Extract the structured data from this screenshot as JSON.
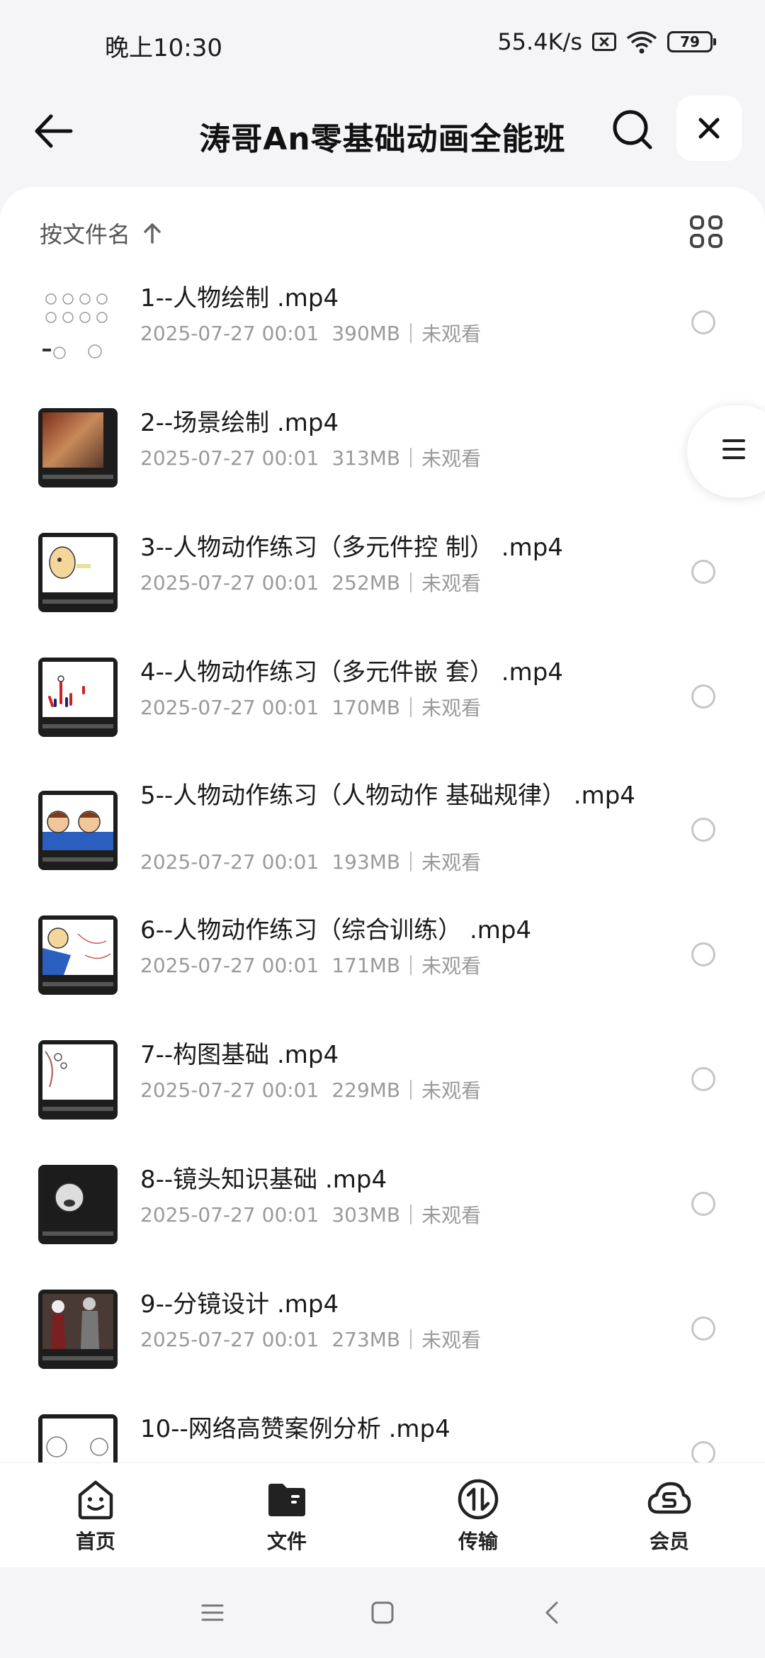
{
  "status": {
    "time": "晚上10:30",
    "speed": "55.4K/s",
    "battery": "79"
  },
  "header": {
    "title": "涛哥An零基础动画全能班"
  },
  "toolbar": {
    "sort_label": "按文件名"
  },
  "files": [
    {
      "name": "1--人物绘制 .mp4",
      "date": "2025-07-27 00:01",
      "size": "390MB",
      "status": "未观看"
    },
    {
      "name": "2--场景绘制 .mp4",
      "date": "2025-07-27 00:01",
      "size": "313MB",
      "status": "未观看"
    },
    {
      "name": "3--人物动作练习（多元件控 制） .mp4",
      "date": "2025-07-27 00:01",
      "size": "252MB",
      "status": "未观看"
    },
    {
      "name": "4--人物动作练习（多元件嵌 套） .mp4",
      "date": "2025-07-27 00:01",
      "size": "170MB",
      "status": "未观看"
    },
    {
      "name": "5--人物动作练习（人物动作 基础规律） .mp4",
      "date": "2025-07-27 00:01",
      "size": "193MB",
      "status": "未观看"
    },
    {
      "name": "6--人物动作练习（综合训练） .mp4",
      "date": "2025-07-27 00:01",
      "size": "171MB",
      "status": "未观看"
    },
    {
      "name": "7--构图基础 .mp4",
      "date": "2025-07-27 00:01",
      "size": "229MB",
      "status": "未观看"
    },
    {
      "name": "8--镜头知识基础 .mp4",
      "date": "2025-07-27 00:01",
      "size": "303MB",
      "status": "未观看"
    },
    {
      "name": "9--分镜设计 .mp4",
      "date": "2025-07-27 00:01",
      "size": "273MB",
      "status": "未观看"
    },
    {
      "name": "10--网络高赞案例分析 .mp4",
      "date": "",
      "size": "",
      "status": ""
    }
  ],
  "tabs": [
    {
      "label": "首页",
      "icon": "smile-icon"
    },
    {
      "label": "文件",
      "icon": "folder-icon"
    },
    {
      "label": "传输",
      "icon": "transfer-icon"
    },
    {
      "label": "会员",
      "icon": "cloud-s-icon"
    }
  ]
}
